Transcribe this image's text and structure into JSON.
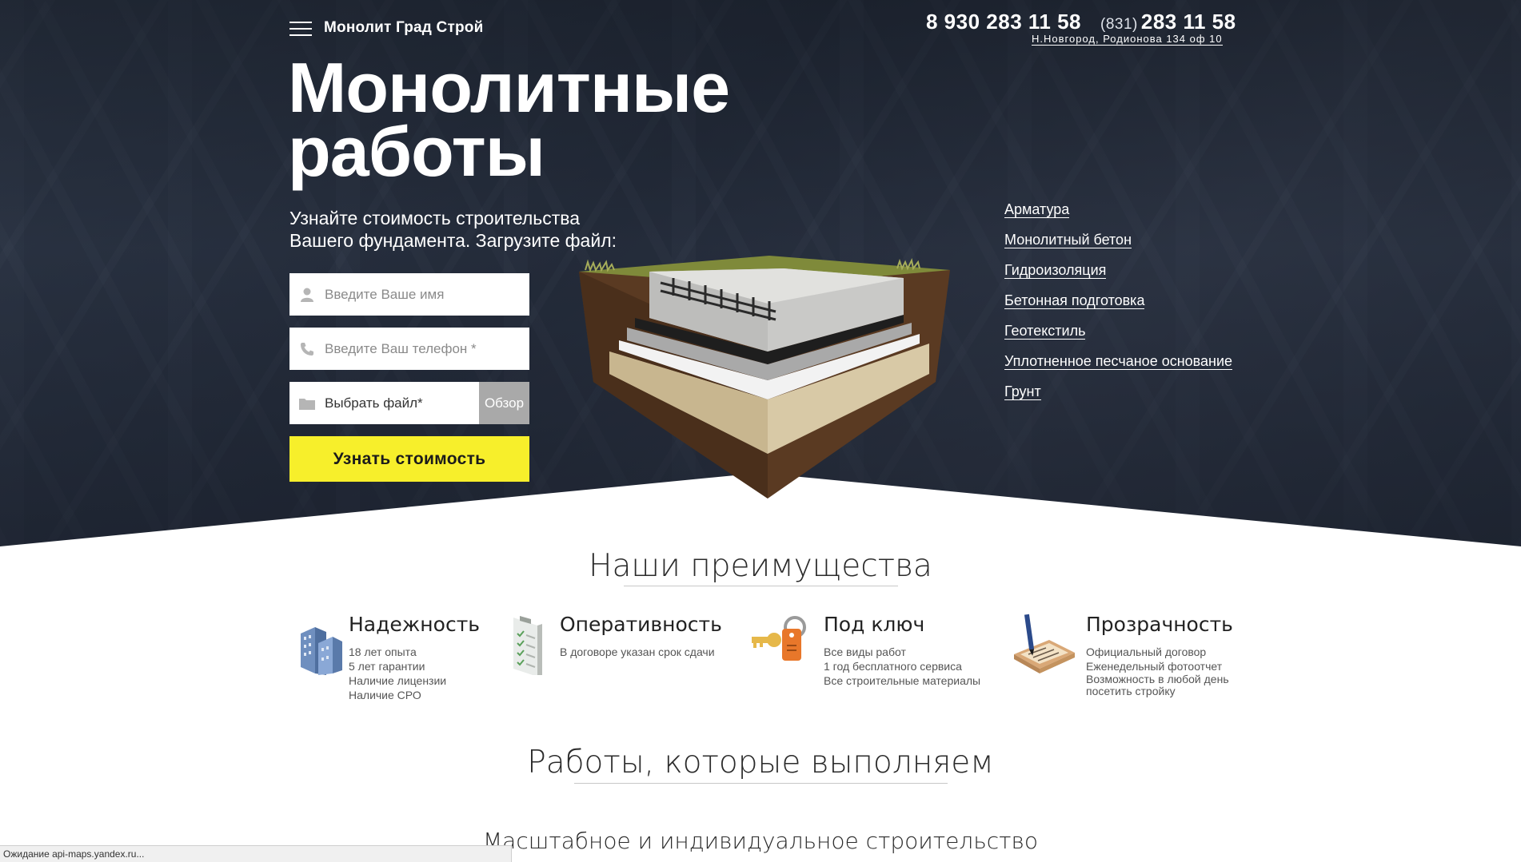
{
  "header": {
    "brand": "Монолит Град Строй",
    "phone_main": "8 930 283 11 58",
    "phone_city_code": "(831)",
    "phone_city": "283 11 58",
    "address": "Н.Новгород, Родионова 134 оф 10"
  },
  "hero": {
    "title_line1": "Монолитные",
    "title_line2": "работы",
    "subtitle_line1": "Узнайте стоимость строительства",
    "subtitle_line2": "Вашего фундамента. Загрузите файл:",
    "form": {
      "name_placeholder": "Введите Ваше имя",
      "phone_placeholder": "Введите Ваш телефон *",
      "file_label": "Выбрать файл*",
      "browse_label": "Обзор",
      "submit_label": "Узнать стоимость"
    },
    "layers": [
      "Арматура",
      "Монолитный бетон",
      "Гидроизоляция",
      "Бетонная подготовка",
      "Геотекстиль",
      "Уплотненное песчаное основание",
      "Грунт"
    ]
  },
  "advantages": {
    "title": "Наши преимущества",
    "items": [
      {
        "icon": "buildings-icon",
        "title": "Надежность",
        "lines": [
          "18 лет опыта",
          "5 лет гарантии",
          "Наличие лицензии",
          "Наличие СРО"
        ]
      },
      {
        "icon": "checklist-icon",
        "title": "Оперативность",
        "lines": [
          "В договоре указан срок сдачи"
        ]
      },
      {
        "icon": "key-icon",
        "title": "Под ключ",
        "lines": [
          "Все виды работ",
          "1 год бесплатного сервиса",
          "Все строительные материалы"
        ]
      },
      {
        "icon": "contract-icon",
        "title": "Прозрачность",
        "lines": [
          "Официальный договор",
          "Еженедельный фотоотчет",
          "Возможность в любой день",
          "посетить стройку"
        ]
      }
    ]
  },
  "works": {
    "title": "Работы, которые выполняем",
    "subtitle": "Масштабное и индивидуальное строительство"
  },
  "status_bar": "Ожидание api-maps.yandex.ru...",
  "colors": {
    "accent": "#f7ef2b",
    "hero_dark": "#2a3140",
    "browse_gray": "#a9a9a9"
  }
}
